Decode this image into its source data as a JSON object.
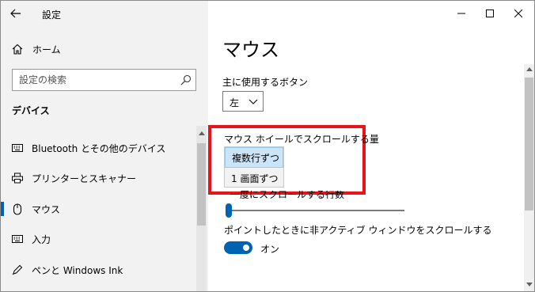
{
  "window": {
    "title": "設定",
    "controls": [
      "minimize",
      "maximize",
      "close"
    ]
  },
  "sidebar": {
    "home_label": "ホーム",
    "search_placeholder": "設定の検索",
    "section_title": "デバイス",
    "items": [
      {
        "label": "Bluetooth とその他のデバイス",
        "icon": "keyboard-icon"
      },
      {
        "label": "プリンターとスキャナー",
        "icon": "printer-icon"
      },
      {
        "label": "マウス",
        "icon": "mouse-icon",
        "selected": true
      },
      {
        "label": "入力",
        "icon": "keyboard-icon"
      },
      {
        "label": "ペンと Windows Ink",
        "icon": "pen-icon"
      }
    ]
  },
  "main": {
    "page_title": "マウス",
    "primary_button": {
      "label": "主に使用するボタン",
      "value": "左"
    },
    "wheel_scroll": {
      "label": "マウス ホイールでスクロールする量",
      "options": [
        "複数行ずつ",
        "1 画面ずつ"
      ],
      "highlighted_option": "複数行ずつ"
    },
    "lines_to_scroll": {
      "label": "一度にスクロールする行数",
      "value_fraction": 0.02
    },
    "inactive_scroll": {
      "label": "ポイントしたときに非アクティブ ウィンドウをスクロールする",
      "toggle_state": "オン"
    }
  },
  "colors": {
    "accent": "#0063b1",
    "highlight_frame": "#e8141c",
    "sidebar_bg": "#f2f2f2",
    "selected_option_bg": "#cce4f7"
  }
}
